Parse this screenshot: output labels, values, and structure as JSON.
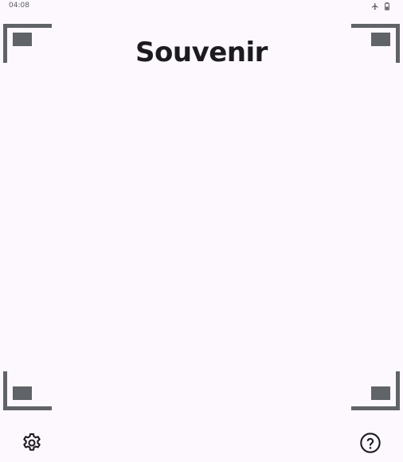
{
  "status_bar": {
    "time": "04:08",
    "icons": [
      "airplane-mode-icon",
      "battery-icon"
    ]
  },
  "app": {
    "title": "Souvenir"
  },
  "bottom_bar": {
    "left_icon": "settings-gear-icon",
    "right_icon": "help-circle-icon"
  },
  "colors": {
    "background": "#fcf8fd",
    "frame": "#606368",
    "title_text": "#1d1b20",
    "icon": "#1d1b20"
  }
}
